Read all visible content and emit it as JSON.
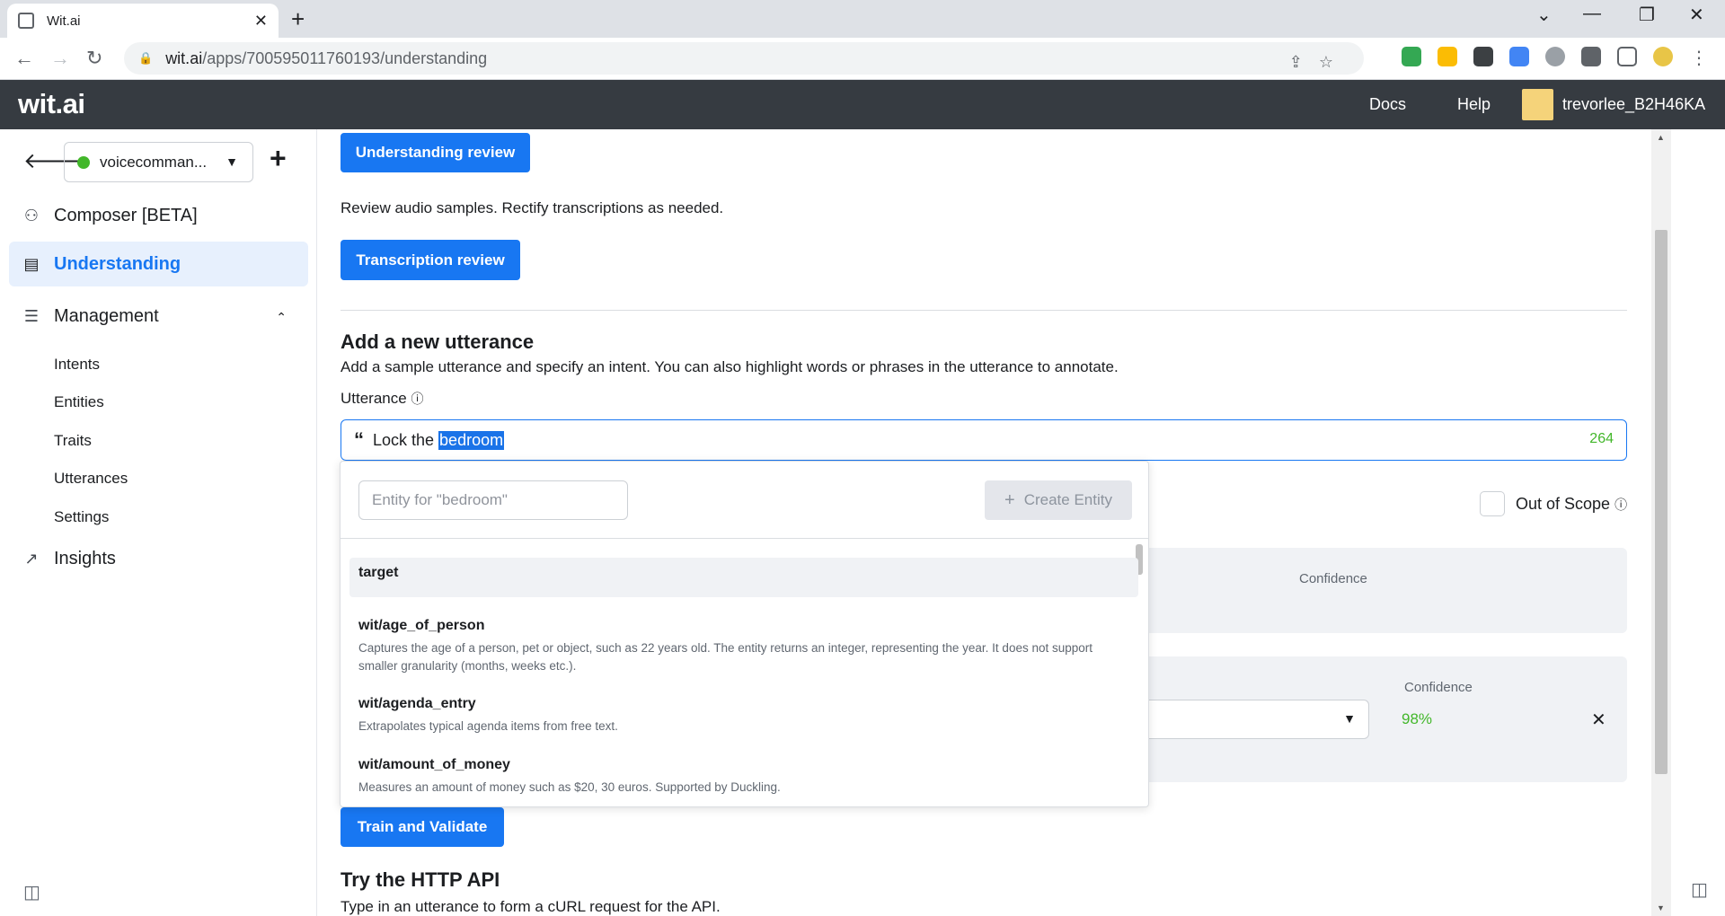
{
  "browser": {
    "tab_title": "Wit.ai",
    "url_host": "wit.ai",
    "url_path": "/apps/700595011760193/understanding"
  },
  "header": {
    "logo": "wit.ai",
    "docs": "Docs",
    "help": "Help",
    "username": "trevorlee_B2H46KA"
  },
  "sidebar": {
    "app_name": "voicecomman...",
    "composer": "Composer [BETA]",
    "understanding": "Understanding",
    "management": "Management",
    "sub": [
      "Intents",
      "Entities",
      "Traits",
      "Utterances",
      "Settings"
    ],
    "insights": "Insights"
  },
  "main": {
    "understanding_review": "Understanding review",
    "review_desc": "Review audio samples. Rectify transcriptions as needed.",
    "transcription_review": "Transcription review",
    "add_title": "Add a new utterance",
    "add_desc": "Add a sample utterance and specify an intent. You can also highlight words or phrases in the utterance to annotate.",
    "utterance_label": "Utterance",
    "utterance_prefix": "Lock the ",
    "utterance_selected": "bedroom",
    "char_count": "264",
    "out_of_scope": "Out of Scope",
    "confidence": "Confidence",
    "confidence_val": "98%",
    "train": "Train and Validate",
    "http_title": "Try the HTTP API",
    "http_desc": "Type in an utterance to form a cURL request for the API."
  },
  "dropdown": {
    "placeholder": "Entity for \"bedroom\"",
    "create": "Create Entity",
    "options": [
      {
        "name": "target",
        "desc": ""
      },
      {
        "name": "wit/age_of_person",
        "desc": "Captures the age of a person, pet or object, such as 22 years old. The entity returns an integer, representing the year. It does not support smaller granularity (months, weeks etc.)."
      },
      {
        "name": "wit/agenda_entry",
        "desc": "Extrapolates typical agenda items from free text."
      },
      {
        "name": "wit/amount_of_money",
        "desc": "Measures an amount of money such as $20, 30 euros. Supported by Duckling."
      }
    ]
  }
}
